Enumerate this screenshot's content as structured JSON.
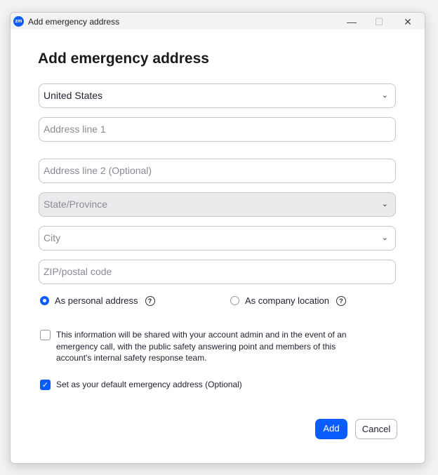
{
  "window": {
    "title": "Add emergency address",
    "logo": "zm",
    "minimize": "—",
    "maximize": "☐",
    "close": "✕"
  },
  "heading": "Add emergency address",
  "fields": {
    "country": "United States",
    "address1_placeholder": "Address line 1",
    "address2_placeholder": "Address line 2 (Optional)",
    "state_placeholder": "State/Province",
    "city_placeholder": "City",
    "zip_placeholder": "ZIP/postal code"
  },
  "address_type": {
    "personal": "As personal address",
    "company": "As company location",
    "selected": "personal"
  },
  "consent": {
    "text": "This information will be shared with your account admin and in the event of an emergency call, with the public safety answering point and members of this account's internal safety response team.",
    "checked": false
  },
  "default": {
    "text": "Set as your default emergency address (Optional)",
    "checked": true
  },
  "buttons": {
    "add": "Add",
    "cancel": "Cancel"
  },
  "colors": {
    "accent": "#0b5cff"
  }
}
